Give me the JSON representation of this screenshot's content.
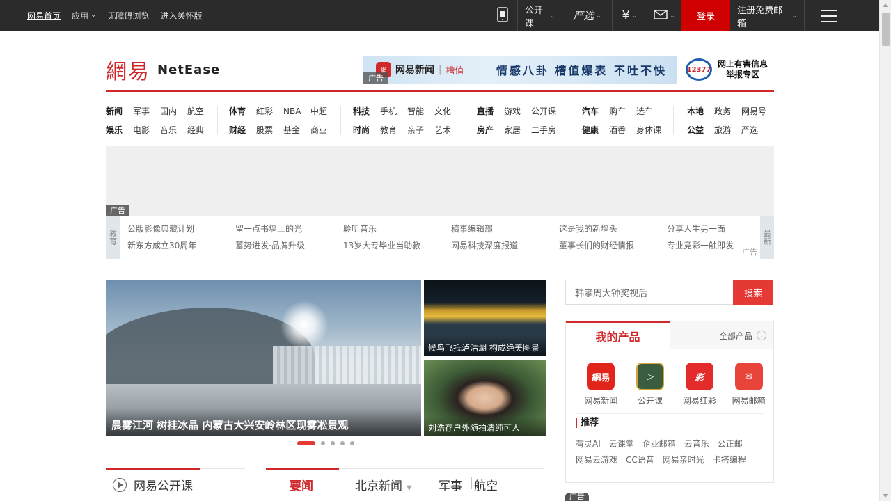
{
  "topbar": {
    "left": {
      "home": "网易首页",
      "apps": "应用",
      "accessible": "无障碍浏览",
      "care_mode": "进入关怀版"
    },
    "right": {
      "open_course": "公开课",
      "yanxuan": "严选",
      "login": "登录",
      "register": "注册免费邮箱"
    }
  },
  "header": {
    "logo_cn": "網易",
    "logo_en": "NetEase",
    "ad_brand": "网易新闻",
    "ad_sub": "槽值",
    "ad_slogan": "情感八卦  槽值爆表  不吐不快",
    "ad_tag": "广告",
    "report_badge": "12377",
    "report_line1": "网上有害信息",
    "report_line2": "举报专区"
  },
  "nav": {
    "groups": [
      {
        "rows": [
          [
            "新闻",
            "军事",
            "国内",
            "航空"
          ],
          [
            "娱乐",
            "电影",
            "音乐",
            "经典"
          ]
        ]
      },
      {
        "rows": [
          [
            "体育",
            "红彩",
            "NBA",
            "中超"
          ],
          [
            "财经",
            "股票",
            "基金",
            "商业"
          ]
        ]
      },
      {
        "rows": [
          [
            "科技",
            "手机",
            "智能",
            "文化"
          ],
          [
            "时尚",
            "教育",
            "亲子",
            "艺术"
          ]
        ]
      },
      {
        "rows": [
          [
            "直播",
            "游戏",
            "公开课"
          ],
          [
            "房产",
            "家居",
            "二手房"
          ]
        ]
      },
      {
        "rows": [
          [
            "汽车",
            "购车",
            "选车"
          ],
          [
            "健康",
            "酒香",
            "身体课"
          ]
        ]
      },
      {
        "rows": [
          [
            "本地",
            "政务",
            "网易号"
          ],
          [
            "公益",
            "旅游",
            "严选"
          ]
        ]
      }
    ]
  },
  "big_ad": {
    "tag": "广告"
  },
  "link_strip": {
    "left_label": "教育",
    "right_label": "最新",
    "tag": "广告",
    "columns": [
      [
        "公版影像典藏计划",
        "新东方成立30周年"
      ],
      [
        "留一点书墙上的光",
        "蓄势进发·品牌升级"
      ],
      [
        "聆听音乐",
        "13岁大专毕业当助教"
      ],
      [
        "稿事编辑部",
        "网易科技深度报道"
      ],
      [
        "这是我的新墙头",
        "董事长们的财经情报"
      ],
      [
        "分享人生另一面",
        "专业竞彩一触即发"
      ]
    ]
  },
  "focus": {
    "hero_caption": "晨雾江河 树挂冰晶 内蒙古大兴安岭林区现雾凇景观",
    "thumb1_caption": "候鸟飞抵泸沽湖 构成绝美图景",
    "thumb2_caption": "刘浩存户外随拍清纯可人",
    "dot_count": 5,
    "active_dot": 0
  },
  "bottom": {
    "open_course_title": "网易公开课",
    "tabs": [
      "要闻",
      "北京新闻",
      "军事",
      "航空"
    ],
    "tab_separator": "|"
  },
  "search": {
    "placeholder": "韩孝周大钟奖视后",
    "button": "搜索"
  },
  "products": {
    "tab_my": "我的产品",
    "tab_all": "全部产品",
    "apps": [
      {
        "label": "网易新闻",
        "icon_text": "網易",
        "icon": "netease-news-icon"
      },
      {
        "label": "公开课",
        "icon_text": "▷",
        "icon": "open-course-icon"
      },
      {
        "label": "网易红彩",
        "icon_text": "彩",
        "icon": "lottery-icon"
      },
      {
        "label": "网易邮箱",
        "icon_text": "✉",
        "icon": "mail-icon"
      }
    ],
    "recommend_title": "推荐",
    "recommend_links": [
      "有灵AI",
      "云课堂",
      "企业邮箱",
      "云音乐",
      "公正邮",
      "网易云游戏",
      "CC语音",
      "网易亲时光",
      "卡搭编程"
    ]
  },
  "right_ad_tag": "广告",
  "colors": {
    "brand_red": "#d0292c",
    "topbar_bg": "#2b2b2b",
    "login_bg": "#d00000",
    "search_btn": "#e53935"
  }
}
